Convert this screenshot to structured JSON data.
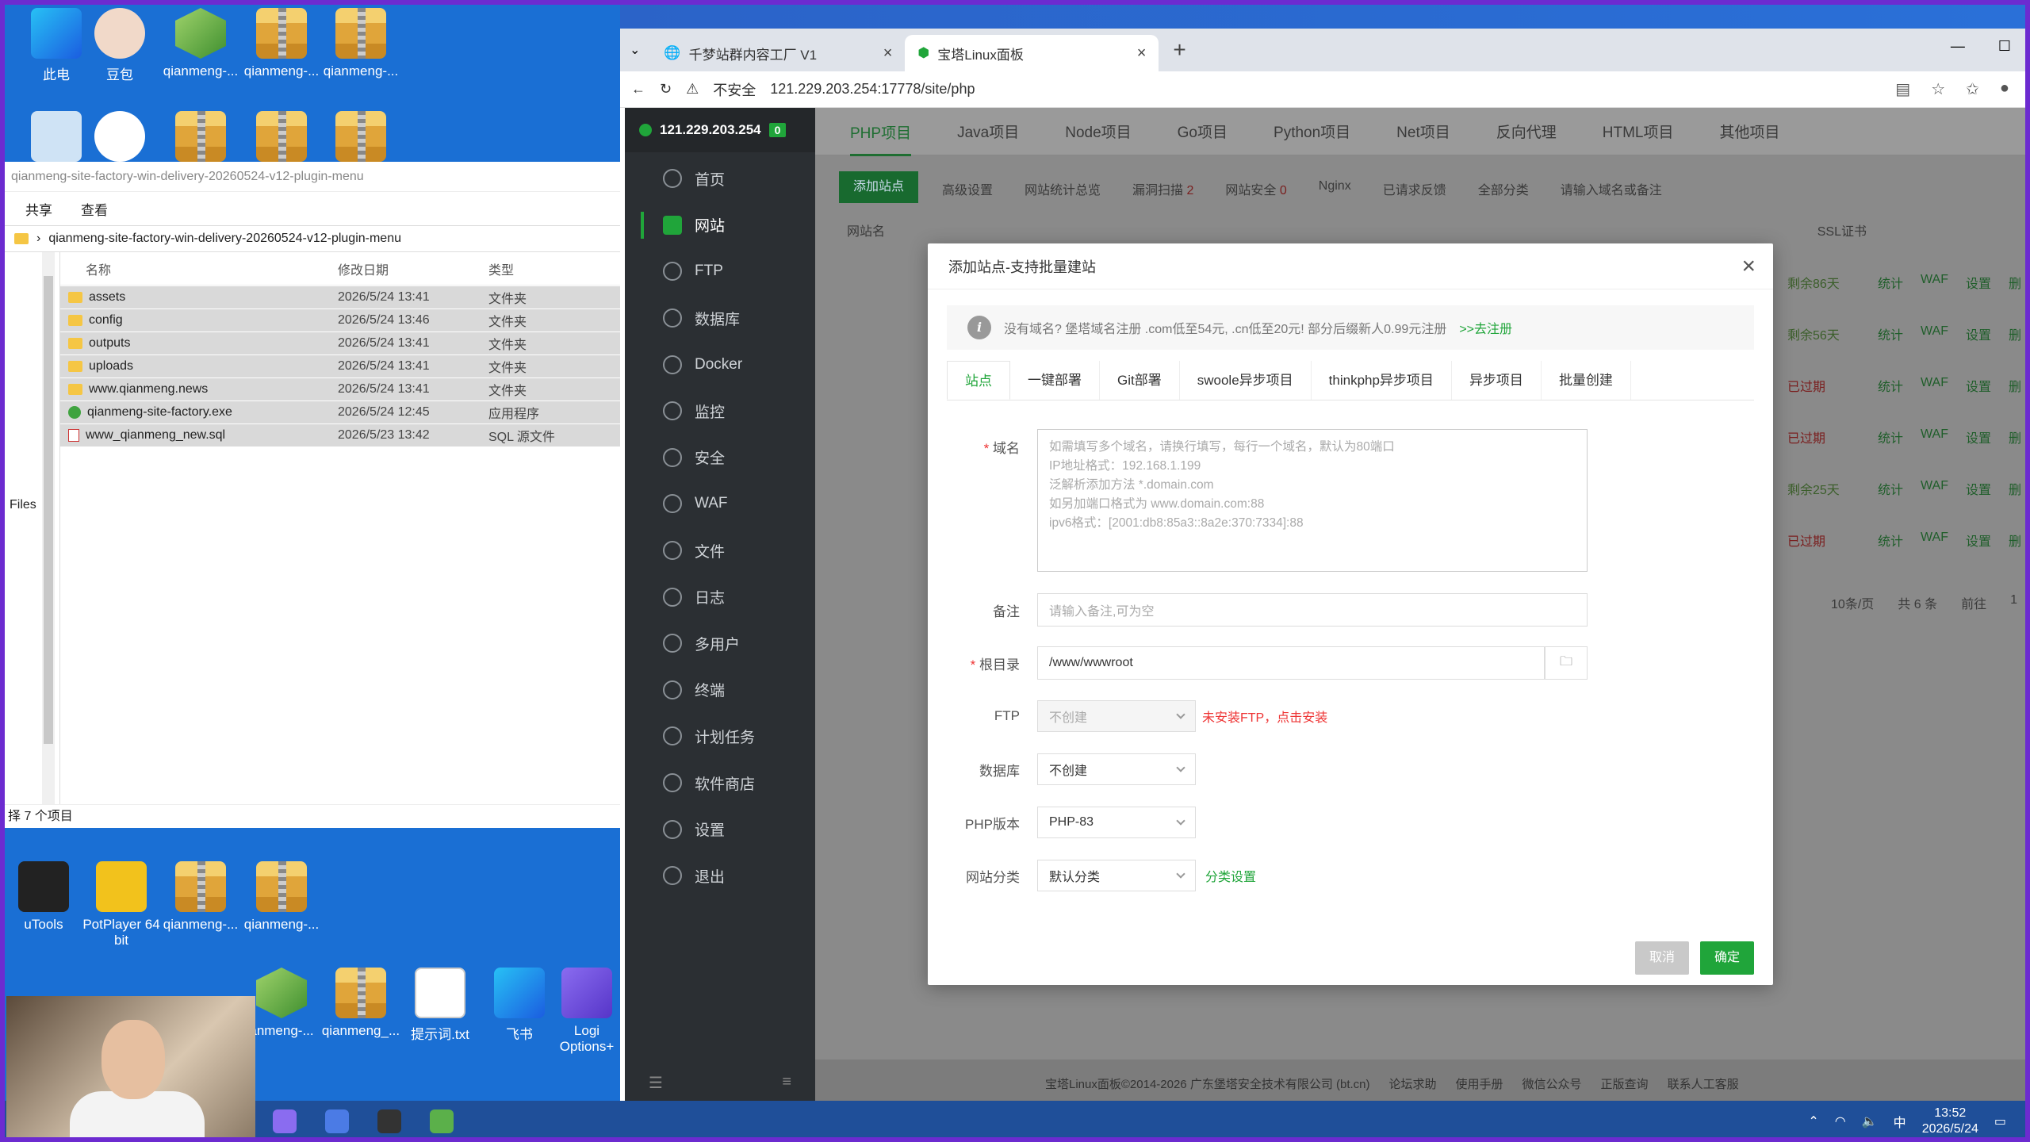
{
  "desktop": {
    "top_icons": [
      {
        "label": "此电"
      },
      {
        "label": "豆包"
      },
      {
        "label": "qianmeng-..."
      },
      {
        "label": "qianmeng-..."
      },
      {
        "label": "qianmeng-..."
      }
    ],
    "bottom_icons": [
      {
        "label": "uTools"
      },
      {
        "label": "PotPlayer 64 bit"
      },
      {
        "label": "qianmeng-..."
      },
      {
        "label": "qianmeng-..."
      }
    ],
    "bottom_icons2": [
      {
        "label": "anmeng-..."
      },
      {
        "label": "qianmeng_..."
      },
      {
        "label": "提示词.txt"
      },
      {
        "label": "飞书"
      },
      {
        "label": "Logi Options+"
      }
    ]
  },
  "explorer": {
    "title": "qianmeng-site-factory-win-delivery-20260524-v12-plugin-menu",
    "menu": [
      "共享",
      "查看"
    ],
    "path": "qianmeng-site-factory-win-delivery-20260524-v12-plugin-menu",
    "nav_label": "Files",
    "columns": [
      "名称",
      "修改日期",
      "类型"
    ],
    "rows": [
      {
        "name": "assets",
        "date": "2026/5/24 13:41",
        "type": "文件夹",
        "kind": "folder"
      },
      {
        "name": "config",
        "date": "2026/5/24 13:46",
        "type": "文件夹",
        "kind": "folder"
      },
      {
        "name": "outputs",
        "date": "2026/5/24 13:41",
        "type": "文件夹",
        "kind": "folder"
      },
      {
        "name": "uploads",
        "date": "2026/5/24 13:41",
        "type": "文件夹",
        "kind": "folder"
      },
      {
        "name": "www.qianmeng.news",
        "date": "2026/5/24 13:41",
        "type": "文件夹",
        "kind": "folder"
      },
      {
        "name": "qianmeng-site-factory.exe",
        "date": "2026/5/24 12:45",
        "type": "应用程序",
        "kind": "exe"
      },
      {
        "name": "www_qianmeng_new.sql",
        "date": "2026/5/23 13:42",
        "type": "SQL 源文件",
        "kind": "sql"
      }
    ],
    "status": "择 7 个项目"
  },
  "browser": {
    "tabs": [
      {
        "label": "千梦站群内容工厂 V1",
        "active": false
      },
      {
        "label": "宝塔Linux面板",
        "active": true
      }
    ],
    "security": "不安全",
    "url": "121.229.203.254:17778/site/php"
  },
  "panel": {
    "ip": "121.229.203.254",
    "badge": "0",
    "menu": [
      {
        "label": "首页",
        "active": false
      },
      {
        "label": "网站",
        "active": true
      },
      {
        "label": "FTP",
        "active": false
      },
      {
        "label": "数据库",
        "active": false
      },
      {
        "label": "Docker",
        "active": false
      },
      {
        "label": "监控",
        "active": false
      },
      {
        "label": "安全",
        "active": false
      },
      {
        "label": "WAF",
        "active": false
      },
      {
        "label": "文件",
        "active": false
      },
      {
        "label": "日志",
        "active": false
      },
      {
        "label": "多用户",
        "active": false
      },
      {
        "label": "终端",
        "active": false
      },
      {
        "label": "计划任务",
        "active": false
      },
      {
        "label": "软件商店",
        "active": false
      },
      {
        "label": "设置",
        "active": false
      },
      {
        "label": "退出",
        "active": false
      }
    ],
    "project_tabs": [
      "PHP项目",
      "Java项目",
      "Node项目",
      "Go项目",
      "Python项目",
      "Net项目",
      "反向代理",
      "HTML项目",
      "其他项目"
    ],
    "toolbar": {
      "add": "添加站点",
      "advanced": "高级设置",
      "stats": "网站统计总览",
      "scan": "漏洞扫描",
      "scan_count": "2",
      "security": "网站安全",
      "security_count": "0",
      "nginx": "Nginx",
      "reverse": "已请求反馈",
      "category": "全部分类",
      "search_placeholder": "请输入域名或备注"
    },
    "bg_header": {
      "site": "网站名",
      "ssl": "SSL证书"
    },
    "bg_rows": [
      {
        "ssl": "剩余86天",
        "state": "ok"
      },
      {
        "ssl": "剩余56天",
        "state": "ok"
      },
      {
        "ssl": "已过期",
        "state": "exp"
      },
      {
        "ssl": "已过期",
        "state": "exp"
      },
      {
        "ssl": "剩余25天",
        "state": "ok"
      },
      {
        "ssl": "已过期",
        "state": "exp"
      }
    ],
    "bg_actions": [
      "统计",
      "WAF",
      "设置",
      "删"
    ],
    "pager": {
      "per": "10条/页",
      "total": "共 6 条",
      "goto": "前往",
      "page": "1"
    },
    "footer": [
      "宝塔Linux面板©2014-2026 广东堡塔安全技术有限公司 (bt.cn)",
      "论坛求助",
      "使用手册",
      "微信公众号",
      "正版查询",
      "联系人工客服"
    ]
  },
  "modal": {
    "title": "添加站点-支持批量建站",
    "notice": "没有域名? 堡塔域名注册 .com低至54元, .cn低至20元! 部分后缀新人0.99元注册",
    "notice_link": ">>去注册",
    "tabs": [
      {
        "label": "站点",
        "active": true
      },
      {
        "label": "一键部署",
        "active": false
      },
      {
        "label": "Git部署",
        "active": false
      },
      {
        "label": "swoole异步项目",
        "active": false
      },
      {
        "label": "thinkphp异步项目",
        "active": false
      },
      {
        "label": "异步项目",
        "active": false
      },
      {
        "label": "批量创建",
        "active": false
      }
    ],
    "domain_label": "域名",
    "domain_placeholder": "如需填写多个域名，请换行填写，每行一个域名，默认为80端口\nIP地址格式：192.168.1.199\n泛解析添加方法 *.domain.com\n如另加端口格式为 www.domain.com:88\nipv6格式：[2001:db8:85a3::8a2e:370:7334]:88",
    "remark_label": "备注",
    "remark_placeholder": "请输入备注,可为空",
    "root_label": "根目录",
    "root_value": "/www/wwwroot",
    "ftp_label": "FTP",
    "ftp_value": "不创建",
    "ftp_hint": "未安装FTP，点击安装",
    "db_label": "数据库",
    "db_value": "不创建",
    "php_label": "PHP版本",
    "php_value": "PHP-83",
    "cat_label": "网站分类",
    "cat_value": "默认分类",
    "cat_link": "分类设置",
    "cancel": "取消",
    "confirm": "确定"
  },
  "taskbar": {
    "time": "13:52",
    "date": "2026/5/24",
    "ime": "中"
  },
  "colors": {
    "accent": "#20a53a",
    "danger": "#e33333",
    "frame": "#6c2bd0"
  }
}
